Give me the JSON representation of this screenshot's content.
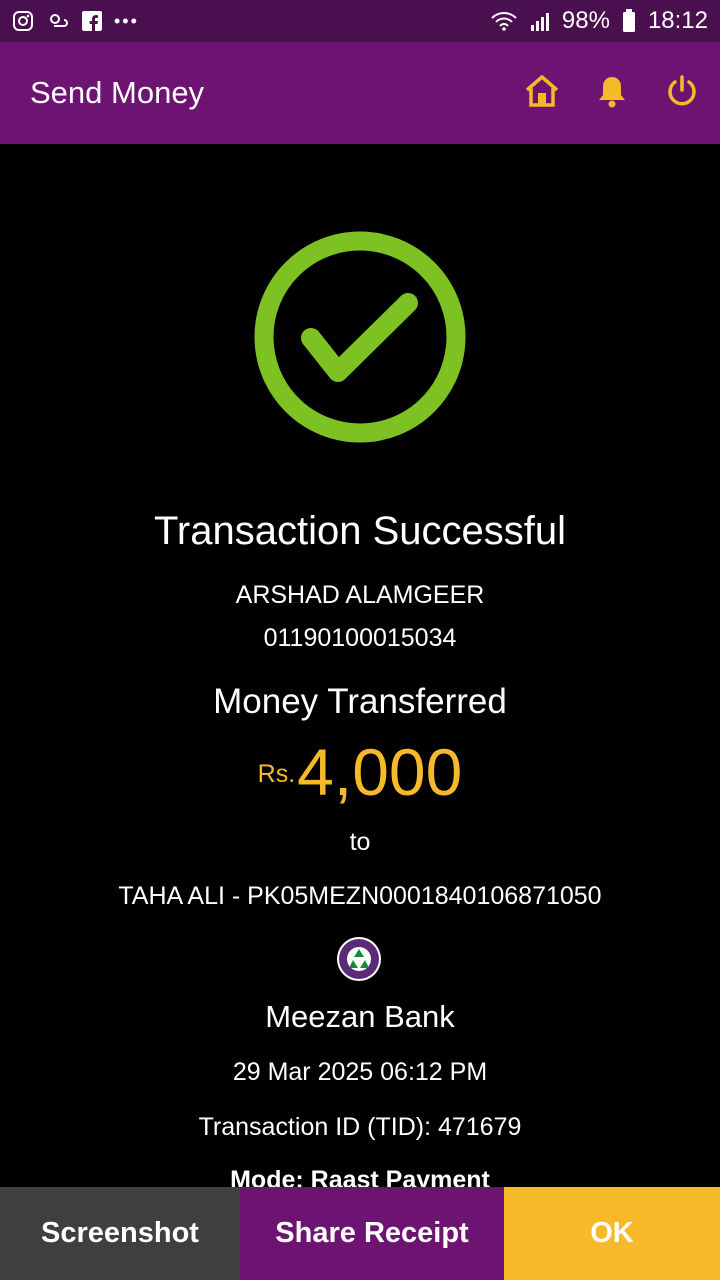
{
  "status_bar": {
    "battery": "98%",
    "time": "18:12",
    "more": "•••"
  },
  "app_bar": {
    "title": "Send Money",
    "icons": [
      "home-icon",
      "bell-icon",
      "power-icon"
    ]
  },
  "receipt": {
    "status": "Transaction Successful",
    "sender_name": "ARSHAD ALAMGEER",
    "sender_account": "01190100015034",
    "label": "Money Transferred",
    "currency": "Rs.",
    "amount": "4,000",
    "to_label": "to",
    "recipient": "TAHA ALI - PK05MEZN0001840106871050",
    "bank_name": "Meezan Bank",
    "datetime": "29 Mar 2025 06:12 PM",
    "transaction_id": "Transaction ID (TID): 471679",
    "mode_partial": "Mode: Raast Payment"
  },
  "actions": {
    "screenshot": "Screenshot",
    "share": "Share Receipt",
    "ok": "OK"
  },
  "colors": {
    "status_bar": "#4a0f4f",
    "app_bar": "#6d1473",
    "accent_yellow": "#f6b928",
    "success_green": "#7dc122",
    "button_gray": "#3f3f3f"
  }
}
